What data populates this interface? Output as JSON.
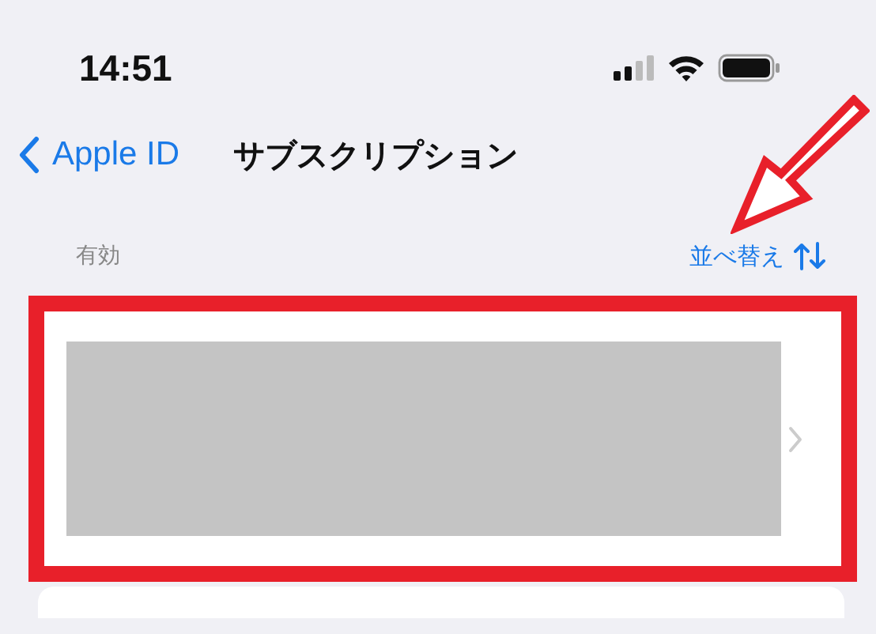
{
  "status_bar": {
    "time": "14:51"
  },
  "nav": {
    "back_label": "Apple ID",
    "title": "サブスクリプション"
  },
  "section": {
    "header": "有効",
    "sort_link": "並べ替え"
  }
}
